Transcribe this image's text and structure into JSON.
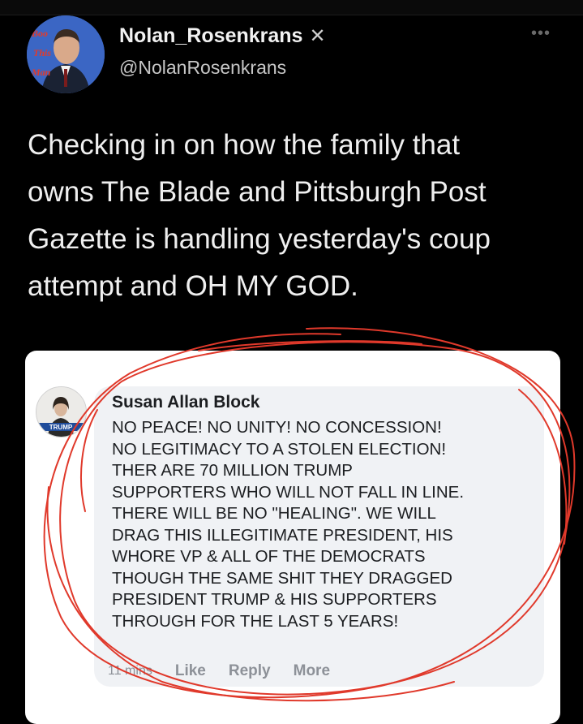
{
  "tweet": {
    "display_name": "Nolan_Rosenkrans",
    "verified_icon": "x-mark-icon",
    "handle": "@NolanRosenkrans",
    "avatar_caption": "Boo This Man",
    "more_icon": "more-dots-icon",
    "text": "Checking in on how the family that\nowns The Blade and Pittsburgh Post\nGazette is handling yesterday's coup\nattempt and OH MY GOD."
  },
  "embedded_comment": {
    "author": "Susan Allan Block",
    "avatar_badge": "TRUMP",
    "text": "NO PEACE! NO UNITY! NO CONCESSION!\nNO LEGITIMACY TO A STOLEN ELECTION!\nTHER ARE 70 MILLION TRUMP\nSUPPORTERS WHO WILL NOT FALL IN LINE.\nTHERE WILL BE NO \"HEALING\". WE WILL\nDRAG THIS ILLEGITIMATE PRESIDENT, HIS\nWHORE VP & ALL OF THE DEMOCRATS\nTHOUGH THE SAME SHIT THEY DRAGGED\nPRESIDENT TRUMP & HIS SUPPORTERS\nTHROUGH FOR THE LAST 5 YEARS!",
    "time": "11 mins",
    "like_label": "Like",
    "reply_label": "Reply",
    "more_label": "More"
  },
  "colors": {
    "background": "#000000",
    "card": "#ffffff",
    "bubble": "#f0f2f5",
    "annotation": "#e0392b"
  }
}
